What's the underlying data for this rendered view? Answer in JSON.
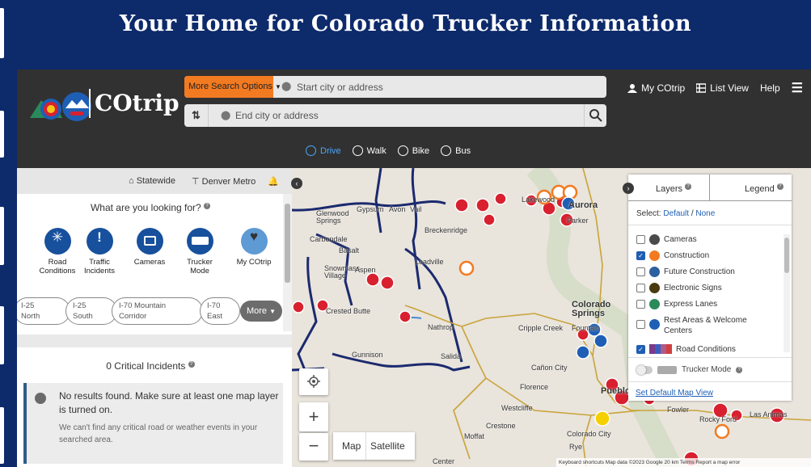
{
  "page": {
    "heading": "Your Home for Colorado Trucker Information"
  },
  "header": {
    "logo_text": "COtrip",
    "more_search": "More Search Options",
    "start_placeholder": "Start city or address",
    "end_placeholder": "End city or address",
    "links": [
      "My COtrip",
      "List View",
      "Help"
    ]
  },
  "modes": [
    {
      "label": "Drive",
      "icon": "car-icon",
      "active": true
    },
    {
      "label": "Walk",
      "icon": "walk-icon",
      "active": false
    },
    {
      "label": "Bike",
      "icon": "bike-icon",
      "active": false
    },
    {
      "label": "Bus",
      "icon": "bus-icon",
      "active": false
    }
  ],
  "sidebar": {
    "statewide": "Statewide",
    "denver_metro": "Denver Metro",
    "looking_for": "What are you looking for?",
    "categories": [
      {
        "label": "Road\nConditions",
        "icon": "snowflake-icon"
      },
      {
        "label": "Traffic\nIncidents",
        "icon": "alert-icon"
      },
      {
        "label": "Cameras",
        "icon": "camera-icon"
      },
      {
        "label": "Trucker\nMode",
        "icon": "truck-icon"
      },
      {
        "label": "My COtrip",
        "icon": "heart-icon"
      }
    ],
    "corridors": [
      {
        "line1": "I-25",
        "line2": "North"
      },
      {
        "line1": "I-25",
        "line2": "South"
      },
      {
        "line1": "I-70 Mountain",
        "line2": "Corridor"
      },
      {
        "line1": "I-70",
        "line2": "East"
      }
    ],
    "more": "More",
    "critical_title": "0 Critical Incidents",
    "no_results": "No results found. Make sure at least one map layer is turned on.",
    "no_results_sub": "We can't find any critical road or weather events in your searched area."
  },
  "layers": {
    "tab_layers": "Layers",
    "tab_legend": "Legend",
    "select_label": "Select:",
    "default": "Default",
    "slash": "/",
    "none": "None",
    "items": [
      {
        "label": "Cameras",
        "checked": false,
        "color": "#4a4a4a"
      },
      {
        "label": "Construction",
        "checked": true,
        "color": "#f27a21"
      },
      {
        "label": "Future Construction",
        "checked": false,
        "color": "#2e5f9e"
      },
      {
        "label": "Electronic Signs",
        "checked": false,
        "color": "#4a3a10"
      },
      {
        "label": "Express Lanes",
        "checked": false,
        "color": "#2a8a5a"
      },
      {
        "label": "Rest Areas & Welcome Centers",
        "checked": false,
        "color": "#1e5fb5"
      },
      {
        "label": "Road Conditions",
        "checked": true,
        "color": "#7a3a8a"
      }
    ],
    "trucker_mode": "Trucker Mode",
    "set_default": "Set Default Map View"
  },
  "map": {
    "labels": [
      {
        "text": "Glenwood\nSprings"
      },
      {
        "text": "Gypsum"
      },
      {
        "text": "Avon"
      },
      {
        "text": "Vail"
      },
      {
        "text": "Breckenridge"
      },
      {
        "text": "Carbondale"
      },
      {
        "text": "Basalt"
      },
      {
        "text": "Snowmass\nVillage"
      },
      {
        "text": "Aspen"
      },
      {
        "text": "Leadville"
      },
      {
        "text": "Crested Butte"
      },
      {
        "text": "Nathrop"
      },
      {
        "text": "Gunnison"
      },
      {
        "text": "Salida"
      },
      {
        "text": "Colorado\nSprings"
      },
      {
        "text": "Cripple Creek"
      },
      {
        "text": "Fountain"
      },
      {
        "text": "Cañon City"
      },
      {
        "text": "Florence"
      },
      {
        "text": "Pueblo"
      },
      {
        "text": "Westcliffe"
      },
      {
        "text": "Crestone"
      },
      {
        "text": "Moffat"
      },
      {
        "text": "Colorado City"
      },
      {
        "text": "Rye"
      },
      {
        "text": "Fowler"
      },
      {
        "text": "Rocky Ford"
      },
      {
        "text": "Las Animas"
      },
      {
        "text": "Lakewood"
      },
      {
        "text": "Aurora"
      },
      {
        "text": "Parker"
      },
      {
        "text": "Center"
      }
    ],
    "map_btn": "Map",
    "satellite_btn": "Satellite",
    "attribution": "Keyboard shortcuts   Map data ©2023 Google   20 km          Terms   Report a map error"
  },
  "colors": {
    "navy": "#0d2a6b",
    "accent_orange": "#f27a21",
    "link_blue": "#1e5fb5",
    "road_navy": "#1b2a6e",
    "closure_red": "#d8202f"
  }
}
